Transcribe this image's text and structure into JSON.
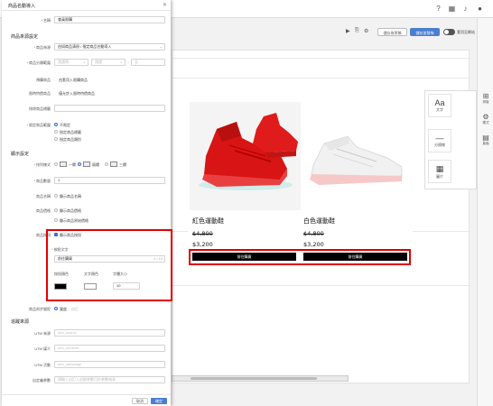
{
  "dialog": {
    "title": "商品名動導入",
    "close_icon": "close-icon",
    "name_label": "名稱",
    "name_value": "會員限購",
    "source_section": "商品來源設定",
    "source_label": "商品來源",
    "source_value": "由如商品清冊 / 指定商品名動導入",
    "category_label": "商品分類範圍",
    "category_select1": "請選擇",
    "category_select2": "請選",
    "category_select3": "至",
    "prebuy_label": "預購商品",
    "prebuy_value": "由套用入限購商品",
    "special_label": "限時特價商品",
    "special_value": "僅允許入限時特價商品",
    "exclude_label": "排除商品標籤",
    "range_label": "限定商品範圍",
    "range_options": [
      "不限定",
      "指定商品標籤",
      "指定商品類別"
    ],
    "display_section": "顯示設定",
    "layout_label": "排列樣式",
    "layout_options": [
      "一欄",
      "兩欄",
      "三欄"
    ],
    "qty_label": "商品數量",
    "qty_value": "1",
    "show_name_label": "商品名稱",
    "show_name_value": "顯示商品名稱",
    "show_price_label": "商品價格",
    "show_price_options": [
      "顯示商品價格",
      "顯示商品原始價格"
    ],
    "buy_btn_label": "商品按鈕",
    "buy_btn_checkbox": "顯示商品按鈕",
    "button_text_label": "按鈕文字",
    "button_text_value": "前往購買",
    "button_text_count": "4 / 10",
    "btn_color_label": "按鈕顏色",
    "text_color_label": "文字顏色",
    "font_size_label": "字體大小",
    "font_size_value": "10",
    "colors": {
      "button": "#000000",
      "text": "#ffffff",
      "accent": "#3b6fd6",
      "highlight": "#e00000"
    },
    "spacing_label": "商品與步間距",
    "spacing_value": "寬度",
    "spacing_placeholder": "自訂",
    "tracking_section": "追蹤來源",
    "utm_source_label": "UTM 來源",
    "utm_source_ph": "utm_source",
    "utm_medium_label": "UTM 媒介",
    "utm_medium_ph": "utm_medium",
    "utm_campaign_label": "UTM 活動",
    "utm_campaign_ph": "utm_campaign",
    "custom_param_label": "自定義參數",
    "custom_param_ph": "請輸入自訂入追蹤參數可於參數報表",
    "cancel": "取消",
    "confirm": "確定"
  },
  "toolbar": {
    "preview_btn": "儲存為草稿",
    "publish_btn": "儲存並發佈",
    "toggle_label": "套用至網站"
  },
  "side_panel": {
    "tiles": [
      {
        "icon": "text-icon",
        "glyph": "Aa",
        "label": "文字"
      },
      {
        "icon": "divider-icon",
        "glyph": "—",
        "label": "分隔線"
      },
      {
        "icon": "image-icon",
        "glyph": "▦",
        "label": "圖片"
      }
    ],
    "rail": [
      {
        "icon": "layout-icon",
        "glyph": "⊞",
        "label": "排版"
      },
      {
        "icon": "style-icon",
        "glyph": "⚙",
        "label": "樣式"
      },
      {
        "icon": "page-icon",
        "glyph": "▤",
        "label": "頁面"
      }
    ]
  },
  "preview": {
    "products": [
      {
        "name": "紅色運動鞋",
        "old_price": "$4,800",
        "price": "$3,200",
        "button": "前往購買"
      },
      {
        "name": "白色運動鞋",
        "old_price": "$4,800",
        "price": "$3,200",
        "button": "前往購買"
      }
    ]
  }
}
